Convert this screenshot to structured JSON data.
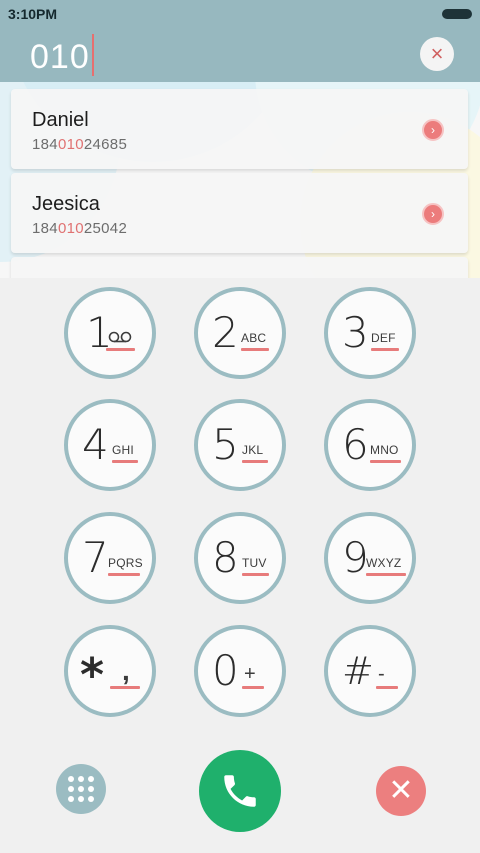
{
  "status": {
    "time": "3:10PM"
  },
  "dialer": {
    "input": "010",
    "clear_icon": "×"
  },
  "contacts": [
    {
      "name": "Daniel",
      "pre": "184",
      "match": "010",
      "post": "24685"
    },
    {
      "name": "Jeesica",
      "pre": "184",
      "match": "010",
      "post": "25042"
    }
  ],
  "keys": [
    {
      "digit": "1",
      "letters": ""
    },
    {
      "digit": "2",
      "letters": "ABC"
    },
    {
      "digit": "3",
      "letters": "DEF"
    },
    {
      "digit": "4",
      "letters": "GHI"
    },
    {
      "digit": "5",
      "letters": "JKL"
    },
    {
      "digit": "6",
      "letters": "MNO"
    },
    {
      "digit": "7",
      "letters": "PQRS"
    },
    {
      "digit": "8",
      "letters": "TUV"
    },
    {
      "digit": "9",
      "letters": "WXYZ"
    },
    {
      "digit": "*",
      "letters": ","
    },
    {
      "digit": "0",
      "letters": "+"
    },
    {
      "digit": "#",
      "letters": "-"
    }
  ],
  "icons": {
    "voicemail": "voicemail-icon",
    "grid": "grid-icon",
    "call": "phone-icon",
    "delete": "delete-icon"
  },
  "colors": {
    "accent": "#97b8bf",
    "highlight": "#e07272",
    "call": "#1fb06c",
    "delete": "#ec7f7f"
  }
}
